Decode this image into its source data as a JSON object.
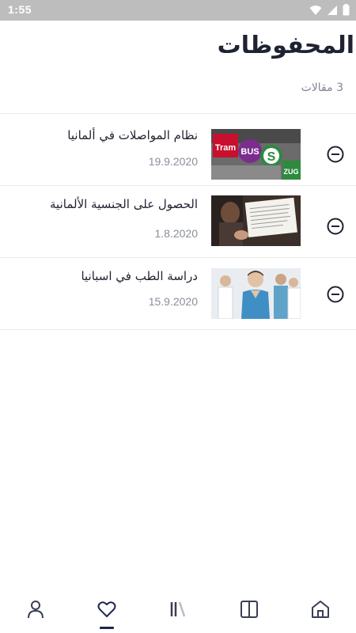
{
  "status_bar": {
    "time": "1:55",
    "icons": [
      "wifi-icon",
      "signal-icon",
      "battery-icon"
    ]
  },
  "header": {
    "title": "المحفوظات",
    "count_text": "3 مقالات"
  },
  "articles": [
    {
      "title": "نظام المواصلات في ألمانيا",
      "date": "19.9.2020",
      "thumb": "transit-signs-image"
    },
    {
      "title": "الحصول على الجنسية الألمانية",
      "date": "1.8.2020",
      "thumb": "citizenship-document-image"
    },
    {
      "title": "دراسة الطب في اسبانيا",
      "date": "15.9.2020",
      "thumb": "medical-staff-image"
    }
  ],
  "bottom_nav": {
    "items": [
      "profile-icon",
      "favorites-icon",
      "library-icon",
      "book-icon",
      "home-icon"
    ],
    "active": "favorites-icon"
  },
  "colors": {
    "accent": "#1e2650",
    "text": "#1f2230",
    "muted": "#8a8f9b",
    "icon": "#3a3f55"
  }
}
